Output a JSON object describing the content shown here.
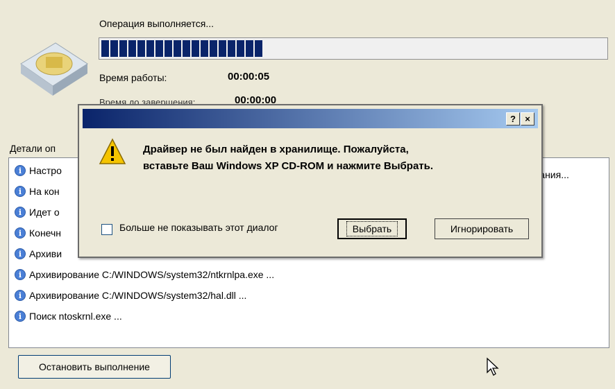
{
  "operation": {
    "status_label": "Операция выполняется...",
    "progress_fraction": 0.33,
    "elapsed_label": "Время работы:",
    "elapsed_value": "00:00:05",
    "remaining_label": "Время до завершения:",
    "remaining_value": "00:00:00"
  },
  "details": {
    "label": "Детали оп",
    "overflow_tail": "вания...",
    "rows": [
      {
        "text": "Настро"
      },
      {
        "text": "На кон"
      },
      {
        "text": "Идет о"
      },
      {
        "text": "Конечн"
      },
      {
        "text": "Архиви"
      },
      {
        "text": "Архивирование C:/WINDOWS/system32/ntkrnlpa.exe ..."
      },
      {
        "text": "Архивирование C:/WINDOWS/system32/hal.dll ..."
      },
      {
        "text": "Поиск ntoskrnl.exe ..."
      }
    ]
  },
  "buttons": {
    "stop": "Остановить выполнение"
  },
  "dialog": {
    "help_glyph": "?",
    "close_glyph": "×",
    "message": "Драйвер не был найден в хранилище. Пожалуйста,\nвставьте Ваш Windows XP CD-ROM и нажмите Выбрать.",
    "checkbox_label": "Больше не показывать этот диалог",
    "checkbox_checked": false,
    "select_button": "Выбрать",
    "ignore_button": "Игнорировать"
  },
  "colors": {
    "progress": "#0a246a",
    "titlebar_start": "#0a246a",
    "titlebar_end": "#a6caf0",
    "info_icon": "#4a7fd6",
    "warning": "#f5c400"
  },
  "icons": {
    "disk": "disk-icon",
    "info": "info-icon",
    "warning": "warning-icon",
    "cursor": "mouse-cursor-icon"
  }
}
